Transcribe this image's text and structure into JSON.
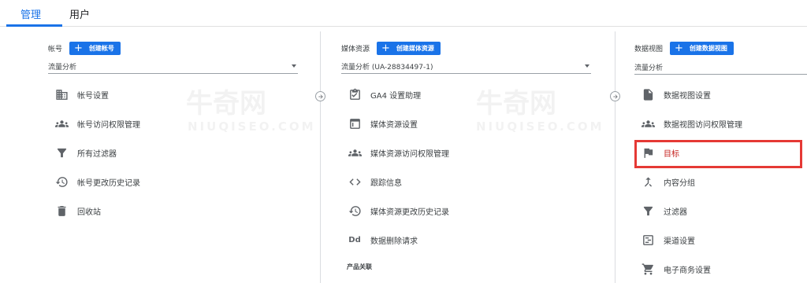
{
  "tabs": [
    {
      "label": "管理",
      "active": true
    },
    {
      "label": "用户",
      "active": false
    }
  ],
  "columns": {
    "account": {
      "title": "帐号",
      "create_label": "创建帐号",
      "selector": "流量分析",
      "items": [
        {
          "label": "帐号设置",
          "icon": "building-icon"
        },
        {
          "label": "帐号访问权限管理",
          "icon": "people-icon"
        },
        {
          "label": "所有过滤器",
          "icon": "filter-icon"
        },
        {
          "label": "帐号更改历史记录",
          "icon": "history-icon"
        },
        {
          "label": "回收站",
          "icon": "trash-icon"
        }
      ]
    },
    "property": {
      "title": "媒体资源",
      "create_label": "创建媒体资源",
      "selector": "流量分析 (UA-28834497-1)",
      "items": [
        {
          "label": "GA4 设置助理",
          "icon": "checklist-icon"
        },
        {
          "label": "媒体资源设置",
          "icon": "window-icon"
        },
        {
          "label": "媒体资源访问权限管理",
          "icon": "people-icon"
        },
        {
          "label": "跟踪信息",
          "icon": "code-icon"
        },
        {
          "label": "媒体资源更改历史记录",
          "icon": "history-icon"
        },
        {
          "label": "数据删除请求",
          "icon": "dd-icon",
          "glyph": "Dd"
        }
      ],
      "section_label": "产品关联"
    },
    "view": {
      "title": "数据视图",
      "create_label": "创建数据视图",
      "selector": "流量分析",
      "items": [
        {
          "label": "数据视图设置",
          "icon": "document-icon"
        },
        {
          "label": "数据视图访问权限管理",
          "icon": "people-icon"
        },
        {
          "label": "目标",
          "icon": "flag-icon",
          "highlight": true
        },
        {
          "label": "内容分组",
          "icon": "merge-icon"
        },
        {
          "label": "过滤器",
          "icon": "filter-icon"
        },
        {
          "label": "渠道设置",
          "icon": "sliders-icon"
        },
        {
          "label": "电子商务设置",
          "icon": "cart-icon"
        }
      ]
    }
  },
  "watermark": {
    "brand": "牛奇网",
    "domain": "NIUQISEO.COM"
  },
  "colors": {
    "accent": "#1a73e8",
    "highlight_border": "#e53935",
    "highlight_text": "#c5221f"
  }
}
